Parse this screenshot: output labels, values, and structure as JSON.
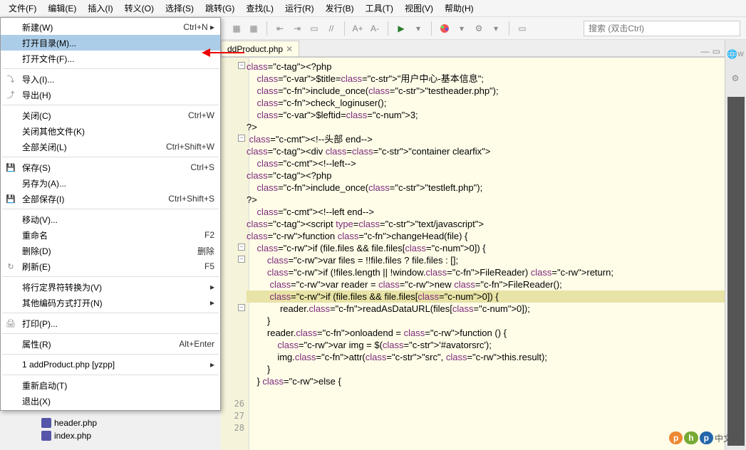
{
  "menubar": {
    "items": [
      {
        "label": "文件(F)"
      },
      {
        "label": "编辑(E)"
      },
      {
        "label": "插入(I)"
      },
      {
        "label": "转义(O)"
      },
      {
        "label": "选择(S)"
      },
      {
        "label": "跳转(G)"
      },
      {
        "label": "查找(L)"
      },
      {
        "label": "运行(R)"
      },
      {
        "label": "发行(B)"
      },
      {
        "label": "工具(T)"
      },
      {
        "label": "视图(V)"
      },
      {
        "label": "帮助(H)"
      }
    ]
  },
  "file_menu": {
    "items": [
      {
        "label": "新建(W)",
        "shortcut": "Ctrl+N ▸",
        "icon": ""
      },
      {
        "label": "打开目录(M)...",
        "shortcut": "",
        "highlighted": true
      },
      {
        "label": "打开文件(F)...",
        "shortcut": ""
      },
      {
        "sep": true
      },
      {
        "label": "导入(I)...",
        "shortcut": "",
        "icon": "⤵"
      },
      {
        "label": "导出(H)",
        "shortcut": "",
        "icon": "⤴"
      },
      {
        "sep": true
      },
      {
        "label": "关闭(C)",
        "shortcut": "Ctrl+W"
      },
      {
        "label": "关闭其他文件(K)",
        "shortcut": ""
      },
      {
        "label": "全部关闭(L)",
        "shortcut": "Ctrl+Shift+W"
      },
      {
        "sep": true
      },
      {
        "label": "保存(S)",
        "shortcut": "Ctrl+S",
        "icon": "💾"
      },
      {
        "label": "另存为(A)...",
        "shortcut": ""
      },
      {
        "label": "全部保存(I)",
        "shortcut": "Ctrl+Shift+S",
        "icon": "💾"
      },
      {
        "sep": true
      },
      {
        "label": "移动(V)...",
        "shortcut": ""
      },
      {
        "label": "重命名",
        "shortcut": "F2"
      },
      {
        "label": "删除(D)",
        "shortcut": "删除"
      },
      {
        "label": "刷新(E)",
        "shortcut": "F5",
        "icon": "↻"
      },
      {
        "sep": true
      },
      {
        "label": "将行定界符转换为(V)",
        "shortcut": "▸"
      },
      {
        "label": "其他编码方式打开(N)",
        "shortcut": "▸"
      },
      {
        "sep": true
      },
      {
        "label": "打印(P)...",
        "shortcut": "",
        "icon": "🖨"
      },
      {
        "sep": true
      },
      {
        "label": "属性(R)",
        "shortcut": "Alt+Enter"
      },
      {
        "sep": true
      },
      {
        "label": "1 addProduct.php  [yzpp]",
        "shortcut": "▸"
      },
      {
        "sep": true
      },
      {
        "label": "重新启动(T)",
        "shortcut": ""
      },
      {
        "label": "退出(X)",
        "shortcut": ""
      }
    ]
  },
  "toolbar": {
    "search_placeholder": "搜索 (双击Ctrl)"
  },
  "tabs": {
    "active": {
      "label": "ddProduct.php",
      "close": "✕"
    }
  },
  "gutter": {
    "start": 26,
    "lines": [
      "26",
      "27",
      "28"
    ]
  },
  "code": {
    "lines": [
      "<?php",
      "    $title=\"用户中心-基本信息\";",
      "    include_once(\"testheader.php\");",
      "    check_loginuser();",
      "    $leftid=3;",
      "?>",
      " <!--头部 end-->",
      "<div class=\"container clearfix\">",
      "    <!--left-->",
      "<?php",
      "    include_once(\"testleft.php\");",
      "?>",
      "    <!--left end-->",
      "<script type=\"text/javascript\">",
      "",
      "function changeHead(file) {",
      "    if (file.files && file.files[0]) {",
      "        var files = !!file.files ? file.files : [];",
      "        if (!files.length || !window.FileReader) return;",
      "         var reader = new FileReader();",
      "         if (file.files && file.files[0]) {",
      "             reader.readAsDataURL(files[0]);",
      "        }",
      "        reader.onloadend = function () {",
      "            var img = $('#avatorsrc');",
      "            img.attr(\"src\", this.result);",
      "        }",
      "    } else {"
    ],
    "highlight_index": 20
  },
  "tree": {
    "files": [
      {
        "label": "header.php"
      },
      {
        "label": "index.php"
      }
    ]
  },
  "right_panel_label": "W",
  "branding": {
    "text": "中文网"
  }
}
